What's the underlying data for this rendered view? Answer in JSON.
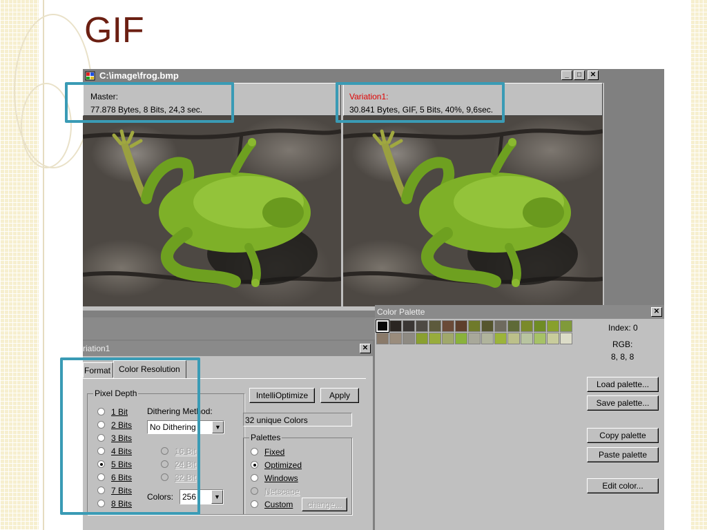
{
  "slide": {
    "title": "GIF"
  },
  "main_window": {
    "title": "C:\\image\\frog.bmp",
    "master": {
      "label": "Master:",
      "info": "77.878 Bytes, 8 Bits, 24,3 sec."
    },
    "variation": {
      "label": "Variation1:",
      "info": "30.841 Bytes, GIF, 5 Bits, 40%, 9,6sec.",
      "label_color": "#e00000"
    }
  },
  "color_palette": {
    "title": "Color Palette",
    "index_label": "Index: 0",
    "rgb_label": "RGB:",
    "rgb_value": "8, 8, 8",
    "buttons": [
      "Load palette...",
      "Save palette...",
      "Copy palette",
      "Paste palette",
      "Edit color..."
    ],
    "swatches_row1": [
      "#080808",
      "#2a2522",
      "#3a3634",
      "#4e4a44",
      "#5d5a3c",
      "#6a4a38",
      "#5e3e2c",
      "#6f7a2a",
      "#55552e",
      "#6e6a5e",
      "#5f6a38",
      "#7a8a2a",
      "#6f8c24",
      "#88a02c",
      "#809a3a"
    ],
    "swatches_row2": [
      "#8a7a6a",
      "#9a8c7c",
      "#8e8a82",
      "#8aa030",
      "#98ac3c",
      "#a0a86a",
      "#8ab23c",
      "#a8a89a",
      "#b0b49c",
      "#9cb43a",
      "#bcc08a",
      "#b8c4a0",
      "#a6c266",
      "#c8cc9c",
      "#dcdcc8"
    ],
    "swatch_colors": {
      "selected_border": "#ffffff"
    }
  },
  "variation_dialog": {
    "title": "riation1",
    "tabs": [
      "Format",
      "Color Resolution"
    ],
    "pixel_depth": {
      "label": "Pixel Depth",
      "options": [
        "1 Bit",
        "2 Bits",
        "3 Bits",
        "4 Bits",
        "5 Bits",
        "6 Bits",
        "7 Bits",
        "8 Bits"
      ],
      "selected": "5 Bits",
      "extra_options": [
        "16 Bit",
        "24 Bit",
        "32 Bit"
      ]
    },
    "dithering": {
      "label": "Dithering Method:",
      "value": "No Dithering"
    },
    "colors": {
      "label": "Colors:",
      "value": "256"
    },
    "intellioptimize_label": "IntelliOptimize",
    "apply_label": "Apply",
    "unique_colors": "32 unique Colors",
    "palettes": {
      "label": "Palettes",
      "options": [
        "Fixed",
        "Optimized",
        "Windows",
        "Netscape",
        "Custom"
      ],
      "selected": "Optimized",
      "change_label": "change..."
    }
  },
  "accent_color": "#3a9bb5"
}
